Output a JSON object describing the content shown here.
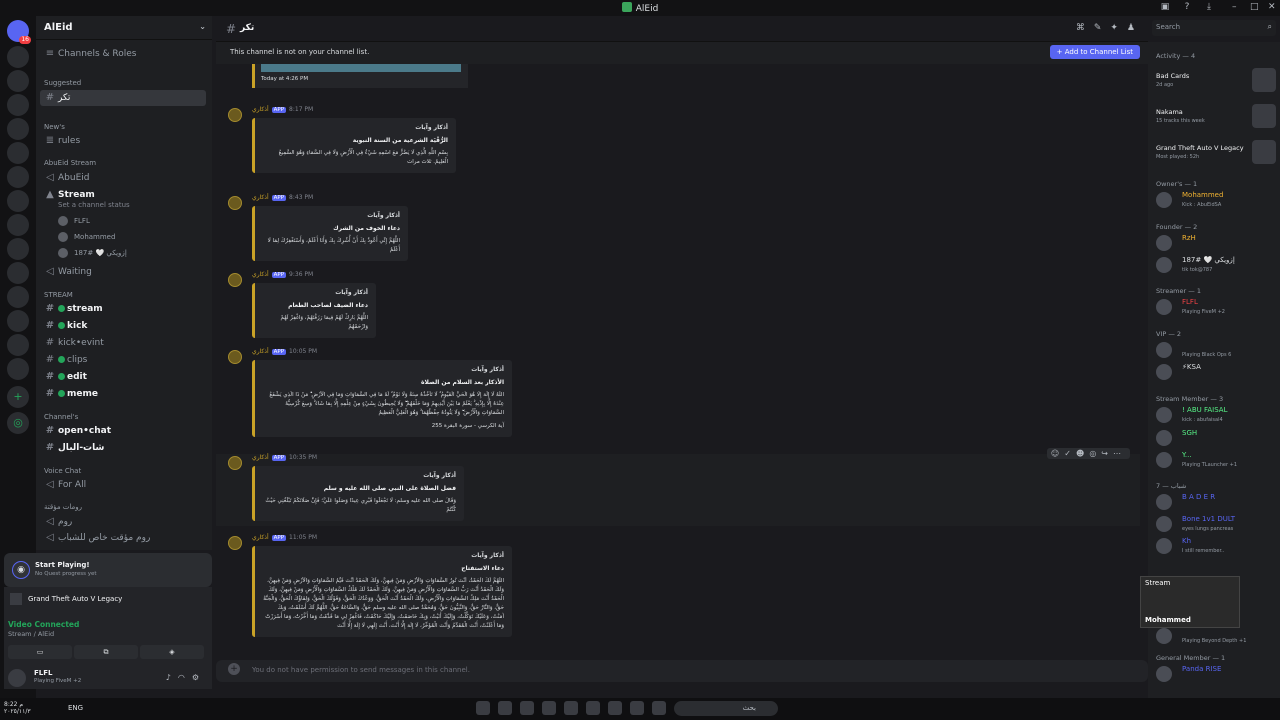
{
  "window": {
    "title": "AlEid",
    "search_placeholder": "Search"
  },
  "server": {
    "name": "AlEid",
    "channels_and_roles": "Channels & Roles",
    "suggested_label": "Suggested",
    "suggested_channel": "تكر",
    "news_category": "New's",
    "rules_channel": "rules",
    "stream_category": "AbuEid Stream",
    "abueid_channel": "AbuEid",
    "stream_channel": "Stream",
    "stream_status": "Set a channel status",
    "voice_users": [
      "FLFL",
      "Mohammed",
      "إزويكي 🤍 #187"
    ],
    "waiting_channel": "Waiting",
    "stream2_category": "STREAM",
    "stream_channels": [
      "stream",
      "kick",
      "kick•evint",
      "clips",
      "edit",
      "meme"
    ],
    "channels_category": "Channel's",
    "channels_list": [
      "open•chat",
      "شات-البال"
    ],
    "voice_chat_category": "Voice Chat",
    "for_all_channel": "For All",
    "temp_category": "رومات مؤقتة",
    "temp_channels": [
      "روم",
      "روم مؤقت خاص للشباب"
    ]
  },
  "quest": {
    "title": "Start Playing!",
    "subtitle": "No Quest progress yet"
  },
  "activity_panel": {
    "game": "Grand Theft Auto V Legacy",
    "voice_status": "Video Connected",
    "voice_sub": "Stream / AlEid",
    "user_name": "FLFL",
    "user_status": "Playing FiveM +2"
  },
  "topbar": {
    "channel_name": "تكر"
  },
  "notice": {
    "text": "This channel is not on your channel list.",
    "button": "+ Add to Channel List"
  },
  "messages": {
    "bot_name": "أذكاري",
    "app_tag": "APP",
    "prev_time": "Today at 4:26 PM",
    "list": [
      {
        "time": "8:17 PM",
        "title": "أذكار وآيات",
        "subtitle": "الرُّقْيَة الشرعية من السنة النبوية",
        "body": "بِسْمِ اللَّهِ الَّذِي لَا يَضُرُّ مَعَ اسْمِهِ شَيْءٌ فِي الْأَرْضِ وَلَا فِي السَّمَاءِ وَهُوَ السَّمِيعُ الْعَلِيمُ. ثلاث مرات"
      },
      {
        "time": "8:43 PM",
        "title": "أذكار وآيات",
        "subtitle": "دعاء الخوف من الشرك",
        "body": "اللَّهُمَّ إِنِّي أَعُوذُ بِكَ أَنْ أُشْرِكَ بِكَ وَأَنَا أَعْلَمُ، وَأَسْتَغْفِرُكَ لِمَا لَا أَعْلَمُ"
      },
      {
        "time": "9:36 PM",
        "title": "أذكار وآيات",
        "subtitle": "دعاء الضيف لصاحب الطعام",
        "body": "اللَّهُمَّ بَارِكْ لَهُمْ فِيمَا رَزَقْتَهُمْ، وَاغْفِرْ لَهُمْ وَارْحَمْهُمْ"
      },
      {
        "time": "10:05 PM",
        "title": "أذكار وآيات",
        "subtitle": "الأذكار بعد السلام من الصلاة",
        "body": "اللَّهُ لَا إِلَٰهَ إِلَّا هُوَ الْحَيُّ الْقَيُّومُ ۚ لَا تَأْخُذُهُ سِنَةٌ وَلَا نَوْمٌ ۚ لَهُ مَا فِي السَّمَاوَاتِ وَمَا فِي الْأَرْضِ ۗ مَنْ ذَا الَّذِي يَشْفَعُ عِنْدَهُ إِلَّا بِإِذْنِهِ ۚ يَعْلَمُ مَا بَيْنَ أَيْدِيهِمْ وَمَا خَلْفَهُمْ ۖ وَلَا يُحِيطُونَ بِشَيْءٍ مِنْ عِلْمِهِ إِلَّا بِمَا شَاءَ ۚ وَسِعَ كُرْسِيُّهُ السَّمَاوَاتِ وَالْأَرْضَ ۖ وَلَا يَئُودُهُ حِفْظُهُمَا ۚ وَهُوَ الْعَلِيُّ الْعَظِيمُ",
        "footer": "آية الكرسي - سورة البقرة 255"
      },
      {
        "time": "10:35 PM",
        "title": "أذكار وآيات",
        "subtitle": "فضل الصلاة على النبي صلى الله عليه و سلم",
        "body": "وَقَالَ صلى الله عليه وسلم: لَا تَجْعَلُوا قَبْرِي عِيدًا وَصَلُّوا عَلَيَّ؛ فَإِنَّ صَلَاتَكُمْ تَبْلُغُنِي حَيْثُ كُنْتُمْ"
      },
      {
        "time": "11:05 PM",
        "title": "أذكار وآيات",
        "subtitle": "دعاء الاستفتاح",
        "body": "اللَّهُمَّ لَكَ الْحَمْدُ، أَنْتَ نُورُ السَّمَاوَاتِ وَالْأَرْضِ وَمَنْ فِيهِنَّ، وَلَكَ الْحَمْدُ أَنْتَ قَيِّمُ السَّمَاوَاتِ وَالْأَرْضِ وَمَنْ فِيهِنَّ، وَلَكَ الْحَمْدُ أَنْتَ رَبُّ السَّمَاوَاتِ وَالْأَرْضِ وَمَنْ فِيهِنَّ، وَلَكَ الْحَمْدُ لَكَ مُلْكُ السَّمَاوَاتِ وَالْأَرْضِ وَمَنْ فِيهِنَّ، وَلَكَ الْحَمْدُ أَنْتَ مَلِكُ السَّمَاوَاتِ وَالْأَرْضِ، وَلَكَ الْحَمْدُ أَنْتَ الْحَقُّ، وَوَعْدُكَ الْحَقُّ، وَقَوْلُكَ الْحَقُّ، وَلِقَاؤُكَ الْحَقُّ، وَالْجَنَّةُ حَقٌّ، وَالنَّارُ حَقٌّ، وَالنَّبِيُّونَ حَقٌّ، وَمُحَمَّدٌ صلى الله عليه وسلم حَقٌّ، وَالسَّاعَةُ حَقٌّ، اللَّهُمَّ لَكَ أَسْلَمْتُ، وَبِكَ آمَنْتُ، وَعَلَيْكَ تَوَكَّلْتُ، وَإِلَيْكَ أَنَبْتُ، وَبِكَ خَاصَمْتُ، وَإِلَيْكَ حَاكَمْتُ، فَاغْفِرْ لِي مَا قَدَّمْتُ وَمَا أَخَّرْتُ، وَمَا أَسْرَرْتُ وَمَا أَعْلَنْتُ، أَنْتَ الْمُقَدِّمُ وَأَنْتَ الْمُؤَخِّرُ، لَا إِلَهَ إِلَّا أَنْتَ، أَنْتَ إِلَهِي لَا إِلَهَ إِلَّا أَنْتَ"
      }
    ]
  },
  "composer": {
    "placeholder": "You do not have permission to send messages in this channel."
  },
  "members": {
    "activity_header": "Activity — 4",
    "activity": [
      {
        "name": "Bad Cards",
        "sub": "2d ago"
      },
      {
        "name": "Nakama",
        "sub": "15 tracks this week"
      },
      {
        "name": "Grand Theft Auto V Legacy",
        "sub": "Most played: 52h"
      }
    ],
    "groups": [
      {
        "header": "Owner's — 1",
        "members": [
          {
            "name": "Mohammed",
            "sub": "Kick : AbuEidSA",
            "color": "#f0b232"
          }
        ]
      },
      {
        "header": "Founder — 2",
        "members": [
          {
            "name": "RzH",
            "sub": "",
            "color": "#f0b232"
          },
          {
            "name": "إزويكي 🤍 #187",
            "sub": "tik tok@787",
            "color": "#dbdee1"
          }
        ]
      },
      {
        "header": "Streamer — 1",
        "members": [
          {
            "name": "FLFL",
            "sub": "Playing FiveM +2",
            "color": "#ed4245"
          }
        ]
      },
      {
        "header": "VIP — 2",
        "members": [
          {
            "name": "",
            "sub": "Playing Black Ops 6",
            "color": "#dbdee1"
          },
          {
            "name": "⚡KSA",
            "sub": "",
            "color": "#dbdee1"
          }
        ]
      },
      {
        "header": "Stream Member — 3",
        "members": [
          {
            "name": "! ABU FAISAL",
            "sub": "kick : abufaisal4",
            "color": "#57f287"
          },
          {
            "name": "SGH",
            "sub": "",
            "color": "#57f287"
          },
          {
            "name": "Y...",
            "sub": "Playing TLauncher +1",
            "color": "#57f287"
          }
        ]
      },
      {
        "header": "شباب — 7",
        "members": [
          {
            "name": "B A D E R",
            "sub": "",
            "color": "#5865f2"
          },
          {
            "name": "Bone 1v1 DULT",
            "sub": "eyes lungs pancreas",
            "color": "#5865f2"
          },
          {
            "name": "Kh",
            "sub": "I still remember..",
            "color": "#5865f2"
          },
          {
            "name": "",
            "sub": "Playing Beyond Depth +1",
            "color": "#5865f2"
          }
        ]
      },
      {
        "header": "General Member — 1",
        "members": [
          {
            "name": "Panda RISE",
            "sub": "",
            "color": "#5865f2"
          }
        ]
      }
    ]
  },
  "stream_pip": {
    "label": "Stream",
    "name": "Mohammed"
  },
  "taskbar": {
    "time": "8:22 م",
    "date": "٢٠٢٥/١١/٣",
    "lang": "ENG",
    "search": "بحث"
  }
}
